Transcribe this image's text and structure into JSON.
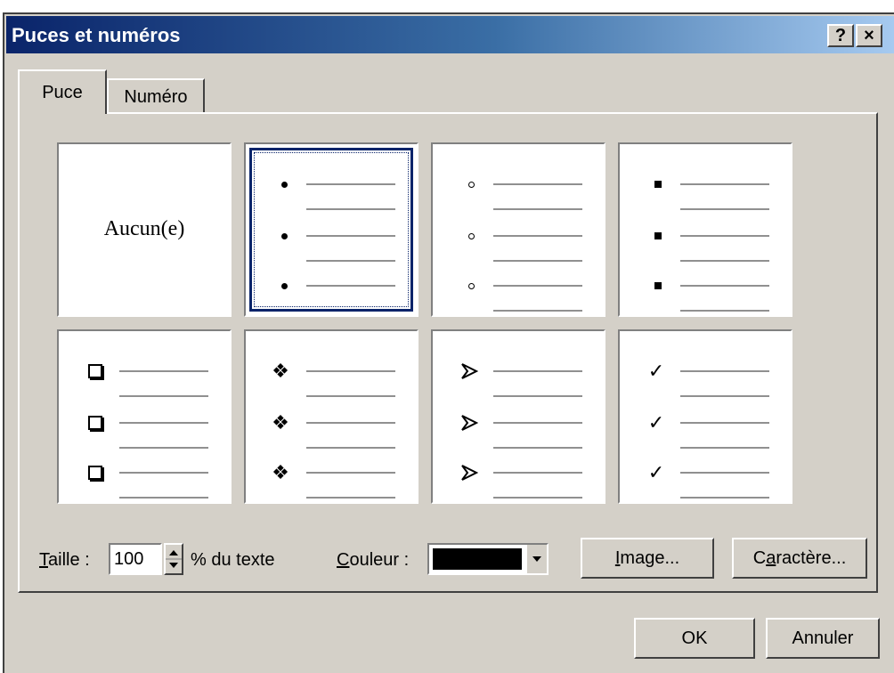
{
  "window": {
    "title": "Puces et numéros",
    "help_btn": "?",
    "close_btn": "×"
  },
  "tabs": [
    {
      "label": "Puce",
      "active": true
    },
    {
      "label": "Numéro",
      "active": false
    }
  ],
  "bullet_grid": {
    "selected_index": 1,
    "none_label": "Aucun(e)",
    "styles": [
      "none",
      "filled-dot",
      "hollow-circle",
      "filled-square",
      "hollow-box",
      "four-diamonds",
      "arrowhead",
      "checkmark"
    ]
  },
  "size": {
    "label_first": "T",
    "label_rest": "aille :",
    "value": "100",
    "suffix": "% du texte"
  },
  "color": {
    "label_first": "C",
    "label_rest": "ouleur :",
    "value_hex": "#000000"
  },
  "buttons": {
    "image_first": "I",
    "image_rest": "mage...",
    "char_pre": "C",
    "char_u": "a",
    "char_rest": "ractère...",
    "ok": "OK",
    "cancel": "Annuler"
  },
  "colors": {
    "face": "#d4d0c8",
    "title_start": "#0a246a",
    "title_end": "#a6caf0"
  }
}
